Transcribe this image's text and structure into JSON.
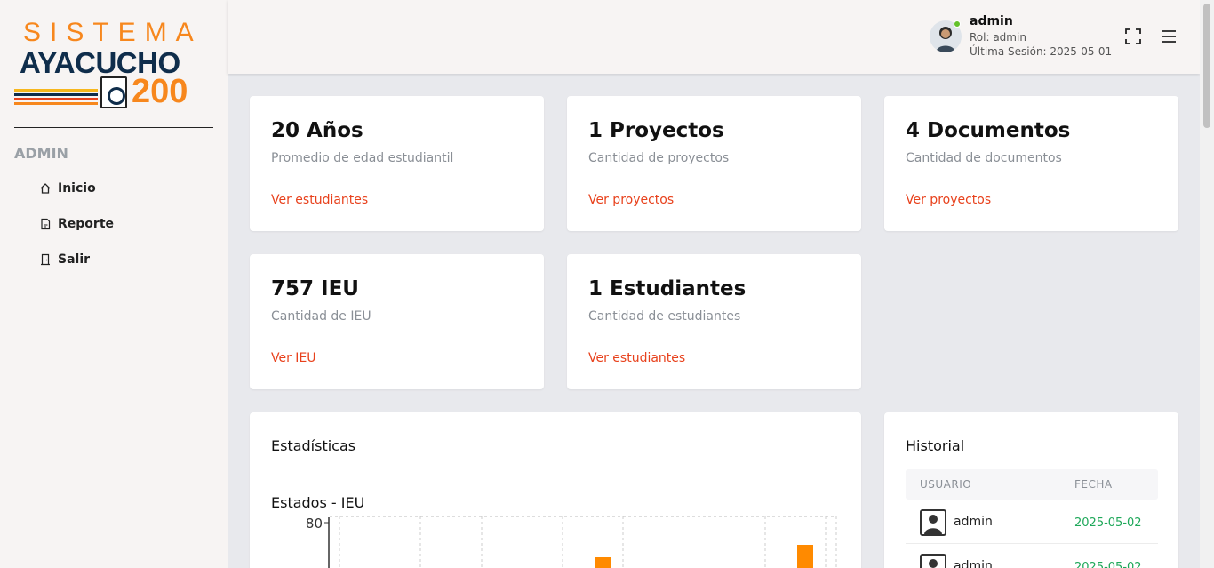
{
  "logo": {
    "top": "SISTEMA",
    "middle": "AYACUCHO",
    "number": "200"
  },
  "sidebar": {
    "section": "ADMIN",
    "items": [
      {
        "label": "Inicio",
        "icon": "home-icon"
      },
      {
        "label": "Reporte",
        "icon": "report-icon"
      },
      {
        "label": "Salir",
        "icon": "exit-door-icon"
      }
    ]
  },
  "header": {
    "user_name": "admin",
    "role": "Rol: admin",
    "last_session": "Última Sesión: 2025-05-01",
    "status_color": "#63c12a"
  },
  "stats": [
    {
      "title": "20 Años",
      "subtitle": "Promedio de edad estudiantil",
      "link": "Ver estudiantes"
    },
    {
      "title": "1 Proyectos",
      "subtitle": "Cantidad de proyectos",
      "link": "Ver proyectos"
    },
    {
      "title": "4 Documentos",
      "subtitle": "Cantidad de documentos",
      "link": "Ver proyectos"
    },
    {
      "title": "757 IEU",
      "subtitle": "Cantidad de IEU",
      "link": "Ver IEU"
    },
    {
      "title": "1 Estudiantes",
      "subtitle": "Cantidad de estudiantes",
      "link": "Ver estudiantes"
    }
  ],
  "statistics": {
    "title": "Estadísticas",
    "chart_title": "Estados - IEU"
  },
  "chart_data": {
    "type": "bar",
    "title": "Estados - IEU",
    "y_tick_top": "80",
    "bar_color": "#ff8a00",
    "grid": true
  },
  "history": {
    "title": "Historial",
    "col_user": "USUARIO",
    "col_date": "FECHA",
    "rows": [
      {
        "user": "admin",
        "date": "2025-05-02"
      },
      {
        "user": "admin",
        "date": "2025-05-02"
      }
    ]
  },
  "colors": {
    "accent": "#e8411c",
    "brand_orange": "#f7871d",
    "brand_navy": "#0f2d4b"
  }
}
